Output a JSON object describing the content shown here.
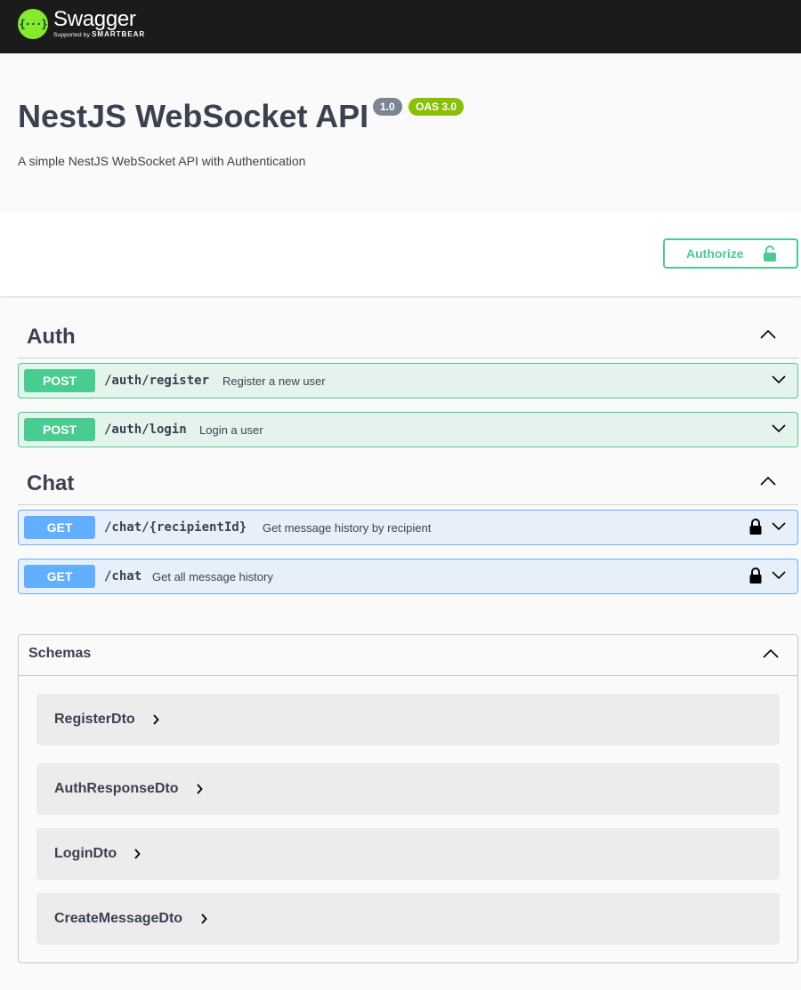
{
  "brand": {
    "logo_glyph": "{···}",
    "name": "Swagger",
    "tagline_prefix": "Supported by",
    "tagline_company": "SMARTBEAR",
    "accent_color": "#85ea2d"
  },
  "info": {
    "title": "NestJS WebSocket API",
    "version": "1.0",
    "oas": "OAS 3.0",
    "description": "A simple NestJS WebSocket API with Authentication"
  },
  "authorize": {
    "label": "Authorize",
    "icon": "lock-open-icon",
    "color": "#49cc90"
  },
  "tags": [
    {
      "name": "Auth",
      "expanded": true,
      "operations": [
        {
          "method": "POST",
          "path": "/auth/register",
          "summary": "Register a new user",
          "locked": false
        },
        {
          "method": "POST",
          "path": "/auth/login",
          "summary": "Login a user",
          "locked": false
        }
      ]
    },
    {
      "name": "Chat",
      "expanded": true,
      "operations": [
        {
          "method": "GET",
          "path": "/chat/{recipientId}",
          "summary": "Get message history by recipient",
          "locked": true
        },
        {
          "method": "GET",
          "path": "/chat",
          "summary": "Get all message history",
          "locked": true
        }
      ]
    }
  ],
  "schemas": {
    "title": "Schemas",
    "items": [
      "RegisterDto",
      "AuthResponseDto",
      "LoginDto",
      "CreateMessageDto"
    ]
  },
  "colors": {
    "post": "#49cc90",
    "get": "#61affe",
    "text": "#3b4151"
  }
}
